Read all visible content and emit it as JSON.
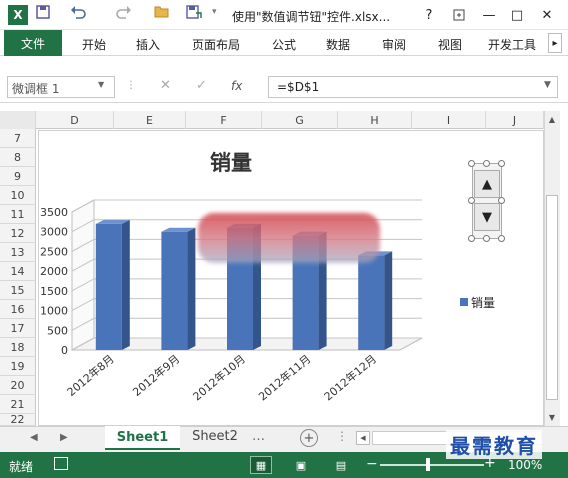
{
  "window": {
    "title": "使用\"数值调节钮\"控件.xlsx...",
    "help": "?",
    "minimize": "—",
    "maximize": "□",
    "close": "✕"
  },
  "quick_access": {
    "icons": [
      "excel-logo-icon",
      "save-icon",
      "undo-icon",
      "redo-icon",
      "open-folder-icon",
      "save-as-icon"
    ]
  },
  "ribbon": {
    "file": "文件",
    "tabs": [
      "开始",
      "插入",
      "页面布局",
      "公式",
      "数据",
      "审阅",
      "视图",
      "开发工具"
    ]
  },
  "name_box": {
    "value": "微调框 1"
  },
  "formula_bar": {
    "fx": "fx",
    "value": "=$D$1"
  },
  "columns": [
    "D",
    "E",
    "F",
    "G",
    "H",
    "I",
    "J"
  ],
  "rows": [
    "7",
    "8",
    "9",
    "10",
    "11",
    "12",
    "13",
    "14",
    "15",
    "16",
    "17",
    "18",
    "19",
    "20",
    "21",
    "22"
  ],
  "chart_data": {
    "type": "bar",
    "title": "销量",
    "categories": [
      "2012年8月",
      "2012年9月",
      "2012年10月",
      "2012年11月",
      "2012年12月"
    ],
    "series": [
      {
        "name": "销量",
        "values": [
          3200,
          3000,
          3100,
          2900,
          2400
        ]
      }
    ],
    "yticks": [
      "3500",
      "3000",
      "2500",
      "2000",
      "1500",
      "1000",
      "500",
      "0"
    ],
    "ylim": [
      0,
      3500
    ],
    "grid": true,
    "legend": "right",
    "colors": {
      "bar": "#4a74b9",
      "bar_side": "#34558c",
      "bar_top": "#6d92cf"
    }
  },
  "spinner": {
    "up": "▲",
    "down": "▼"
  },
  "sheet_tabs": {
    "tabs": [
      "Sheet1",
      "Sheet2"
    ],
    "active": "Sheet1",
    "more": "…",
    "add": "+"
  },
  "status": {
    "ready": "就绪",
    "zoom": "100%",
    "minus": "−",
    "plus": "+"
  },
  "watermark": "最需教育",
  "colors": {
    "accent": "#217346",
    "status_bar": "#217346",
    "watermark": "#1f4fa8"
  }
}
